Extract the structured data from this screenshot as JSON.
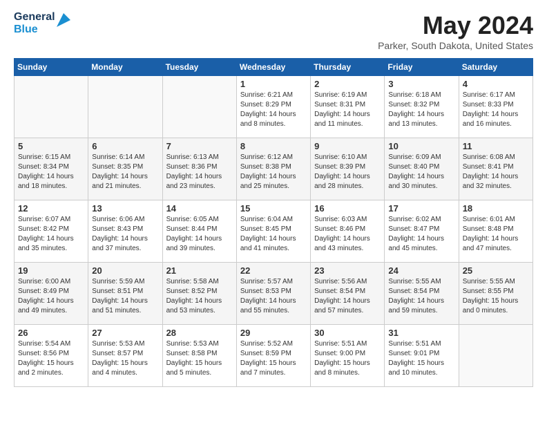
{
  "header": {
    "logo_line1": "General",
    "logo_line2": "Blue",
    "month_year": "May 2024",
    "location": "Parker, South Dakota, United States"
  },
  "days_of_week": [
    "Sunday",
    "Monday",
    "Tuesday",
    "Wednesday",
    "Thursday",
    "Friday",
    "Saturday"
  ],
  "weeks": [
    [
      {
        "day": null,
        "data": null
      },
      {
        "day": null,
        "data": null
      },
      {
        "day": null,
        "data": null
      },
      {
        "day": "1",
        "data": "Sunrise: 6:21 AM\nSunset: 8:29 PM\nDaylight: 14 hours\nand 8 minutes."
      },
      {
        "day": "2",
        "data": "Sunrise: 6:19 AM\nSunset: 8:31 PM\nDaylight: 14 hours\nand 11 minutes."
      },
      {
        "day": "3",
        "data": "Sunrise: 6:18 AM\nSunset: 8:32 PM\nDaylight: 14 hours\nand 13 minutes."
      },
      {
        "day": "4",
        "data": "Sunrise: 6:17 AM\nSunset: 8:33 PM\nDaylight: 14 hours\nand 16 minutes."
      }
    ],
    [
      {
        "day": "5",
        "data": "Sunrise: 6:15 AM\nSunset: 8:34 PM\nDaylight: 14 hours\nand 18 minutes."
      },
      {
        "day": "6",
        "data": "Sunrise: 6:14 AM\nSunset: 8:35 PM\nDaylight: 14 hours\nand 21 minutes."
      },
      {
        "day": "7",
        "data": "Sunrise: 6:13 AM\nSunset: 8:36 PM\nDaylight: 14 hours\nand 23 minutes."
      },
      {
        "day": "8",
        "data": "Sunrise: 6:12 AM\nSunset: 8:38 PM\nDaylight: 14 hours\nand 25 minutes."
      },
      {
        "day": "9",
        "data": "Sunrise: 6:10 AM\nSunset: 8:39 PM\nDaylight: 14 hours\nand 28 minutes."
      },
      {
        "day": "10",
        "data": "Sunrise: 6:09 AM\nSunset: 8:40 PM\nDaylight: 14 hours\nand 30 minutes."
      },
      {
        "day": "11",
        "data": "Sunrise: 6:08 AM\nSunset: 8:41 PM\nDaylight: 14 hours\nand 32 minutes."
      }
    ],
    [
      {
        "day": "12",
        "data": "Sunrise: 6:07 AM\nSunset: 8:42 PM\nDaylight: 14 hours\nand 35 minutes."
      },
      {
        "day": "13",
        "data": "Sunrise: 6:06 AM\nSunset: 8:43 PM\nDaylight: 14 hours\nand 37 minutes."
      },
      {
        "day": "14",
        "data": "Sunrise: 6:05 AM\nSunset: 8:44 PM\nDaylight: 14 hours\nand 39 minutes."
      },
      {
        "day": "15",
        "data": "Sunrise: 6:04 AM\nSunset: 8:45 PM\nDaylight: 14 hours\nand 41 minutes."
      },
      {
        "day": "16",
        "data": "Sunrise: 6:03 AM\nSunset: 8:46 PM\nDaylight: 14 hours\nand 43 minutes."
      },
      {
        "day": "17",
        "data": "Sunrise: 6:02 AM\nSunset: 8:47 PM\nDaylight: 14 hours\nand 45 minutes."
      },
      {
        "day": "18",
        "data": "Sunrise: 6:01 AM\nSunset: 8:48 PM\nDaylight: 14 hours\nand 47 minutes."
      }
    ],
    [
      {
        "day": "19",
        "data": "Sunrise: 6:00 AM\nSunset: 8:49 PM\nDaylight: 14 hours\nand 49 minutes."
      },
      {
        "day": "20",
        "data": "Sunrise: 5:59 AM\nSunset: 8:51 PM\nDaylight: 14 hours\nand 51 minutes."
      },
      {
        "day": "21",
        "data": "Sunrise: 5:58 AM\nSunset: 8:52 PM\nDaylight: 14 hours\nand 53 minutes."
      },
      {
        "day": "22",
        "data": "Sunrise: 5:57 AM\nSunset: 8:53 PM\nDaylight: 14 hours\nand 55 minutes."
      },
      {
        "day": "23",
        "data": "Sunrise: 5:56 AM\nSunset: 8:54 PM\nDaylight: 14 hours\nand 57 minutes."
      },
      {
        "day": "24",
        "data": "Sunrise: 5:55 AM\nSunset: 8:54 PM\nDaylight: 14 hours\nand 59 minutes."
      },
      {
        "day": "25",
        "data": "Sunrise: 5:55 AM\nSunset: 8:55 PM\nDaylight: 15 hours\nand 0 minutes."
      }
    ],
    [
      {
        "day": "26",
        "data": "Sunrise: 5:54 AM\nSunset: 8:56 PM\nDaylight: 15 hours\nand 2 minutes."
      },
      {
        "day": "27",
        "data": "Sunrise: 5:53 AM\nSunset: 8:57 PM\nDaylight: 15 hours\nand 4 minutes."
      },
      {
        "day": "28",
        "data": "Sunrise: 5:53 AM\nSunset: 8:58 PM\nDaylight: 15 hours\nand 5 minutes."
      },
      {
        "day": "29",
        "data": "Sunrise: 5:52 AM\nSunset: 8:59 PM\nDaylight: 15 hours\nand 7 minutes."
      },
      {
        "day": "30",
        "data": "Sunrise: 5:51 AM\nSunset: 9:00 PM\nDaylight: 15 hours\nand 8 minutes."
      },
      {
        "day": "31",
        "data": "Sunrise: 5:51 AM\nSunset: 9:01 PM\nDaylight: 15 hours\nand 10 minutes."
      },
      {
        "day": null,
        "data": null
      }
    ]
  ]
}
